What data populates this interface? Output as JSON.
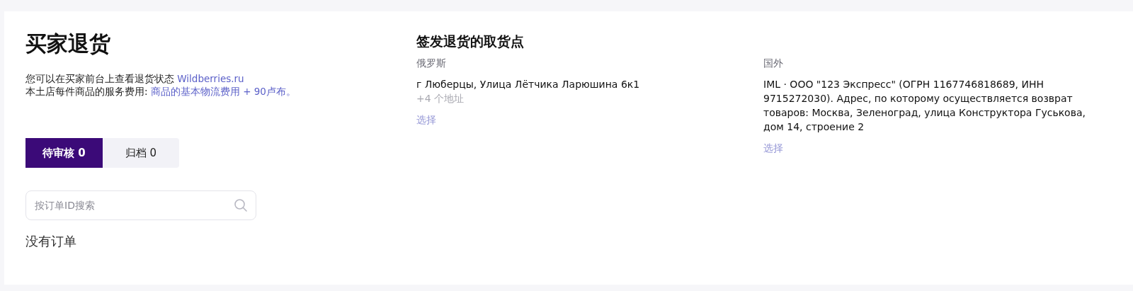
{
  "title": "买家退货",
  "info_lines": [
    {
      "text": "您可以在买家前台上查看退货状态",
      "link": "Wildberries.ru"
    },
    {
      "text": "本土店每件商品的服务费用:",
      "link": "商品的基本物流费用 + 90卢布。"
    }
  ],
  "tabs": [
    {
      "label": "待审核 0",
      "selected": true
    },
    {
      "label": "归档 0",
      "selected": false
    }
  ],
  "search": {
    "placeholder": "按订单ID搜索"
  },
  "empty_message": "没有订单",
  "pickup": {
    "heading": "签发退货的取货点",
    "regions": [
      {
        "label": "俄罗斯",
        "address": "г Люберцы, Улица Лётчика Ларюшина 6к1",
        "more": "+4 个地址",
        "action": {
          "label": "选择",
          "disabled": true
        }
      },
      {
        "label": "国外",
        "address": "IML · ООО \"123 Экспресс\" (ОГРН 1167746818689, ИНН 9715272030). Адрес, по которому осуществляется возврат товаров: Москва, Зеленоград, улица Конструктора Гуськова, дом 14, строение 2",
        "action": {
          "label": "选择",
          "disabled": true
        }
      }
    ]
  }
}
